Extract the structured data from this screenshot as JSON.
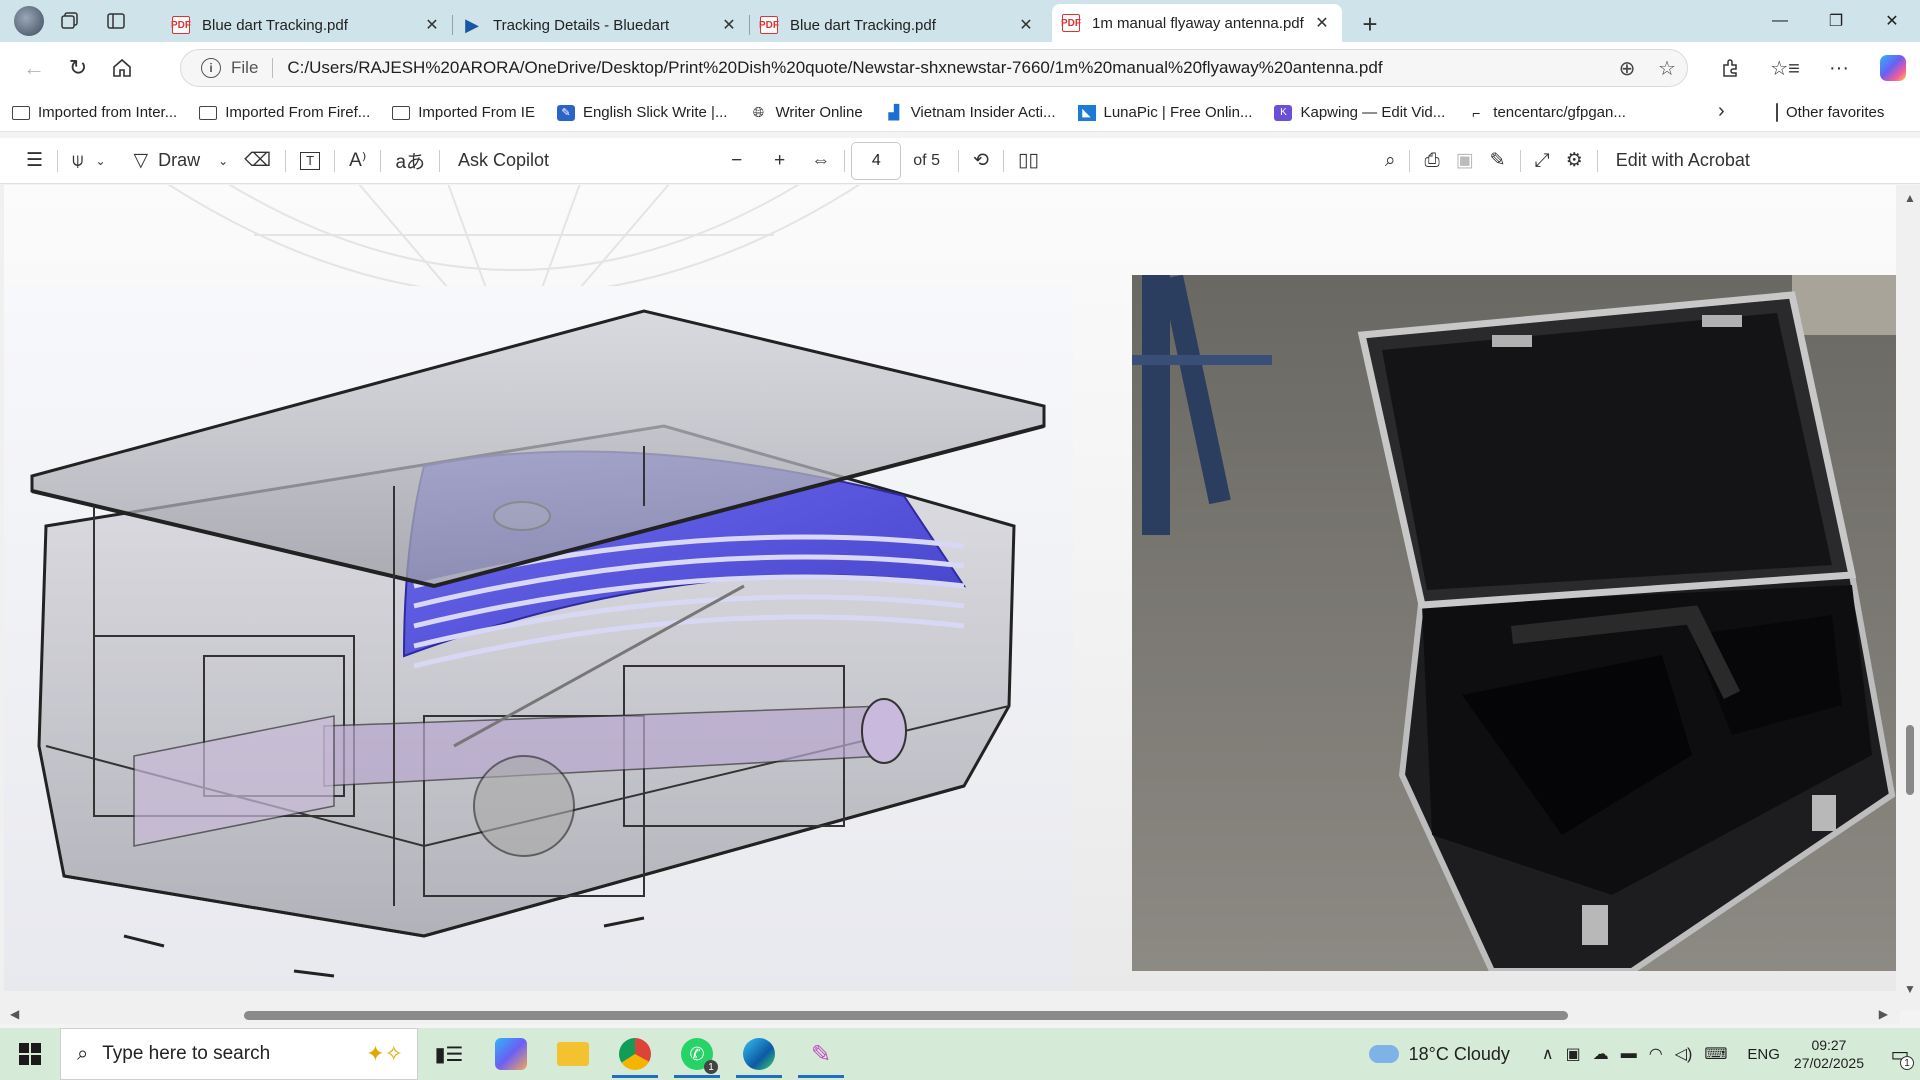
{
  "tabs": [
    {
      "title": "Blue dart Tracking.pdf",
      "type": "pdf",
      "active": false
    },
    {
      "title": "Tracking Details - Bluedart",
      "type": "bluedart",
      "active": false
    },
    {
      "title": "Blue dart Tracking.pdf",
      "type": "pdf",
      "active": false
    },
    {
      "title": "1m manual flyaway antenna.pdf",
      "type": "pdf",
      "active": true
    }
  ],
  "address": {
    "scheme": "File",
    "url": "C:/Users/RAJESH%20ARORA/OneDrive/Desktop/Print%20Dish%20quote/Newstar-shxnewstar-7660/1m%20manual%20flyaway%20antenna.pdf"
  },
  "favorites": {
    "items": [
      {
        "label": "Imported from Inter...",
        "icon": "folder-icon"
      },
      {
        "label": "Imported From Firef...",
        "icon": "folder-icon"
      },
      {
        "label": "Imported From IE",
        "icon": "folder-icon"
      },
      {
        "label": "English Slick Write |...",
        "icon": "pen-icon"
      },
      {
        "label": "Writer Online",
        "icon": "globe-icon"
      },
      {
        "label": "Vietnam Insider Acti...",
        "icon": "chart-icon"
      },
      {
        "label": "LunaPic | Free Onlin...",
        "icon": "lunapic-icon"
      },
      {
        "label": "Kapwing — Edit Vid...",
        "icon": "kapwing-icon"
      },
      {
        "label": "tencentarc/gfpgan...",
        "icon": "doc-icon"
      }
    ],
    "other": "Other favorites"
  },
  "pdf_toolbar": {
    "draw_label": "Draw",
    "ask_copilot": "Ask Copilot",
    "page": "4",
    "of_pages": "of 5",
    "edit_acrobat": "Edit with Acrobat"
  },
  "taskbar": {
    "search_placeholder": "Type here to search",
    "whatsapp_badge": "1",
    "weather": "18°C  Cloudy",
    "lang": "ENG",
    "time": "09:27",
    "date": "27/02/2025",
    "notif_count": "1"
  },
  "colors": {
    "tabstrip": "#cfe3ea",
    "taskbar": "#d6ead8",
    "accent": "#1f6fbf",
    "cad_blue": "#5b58e0"
  }
}
